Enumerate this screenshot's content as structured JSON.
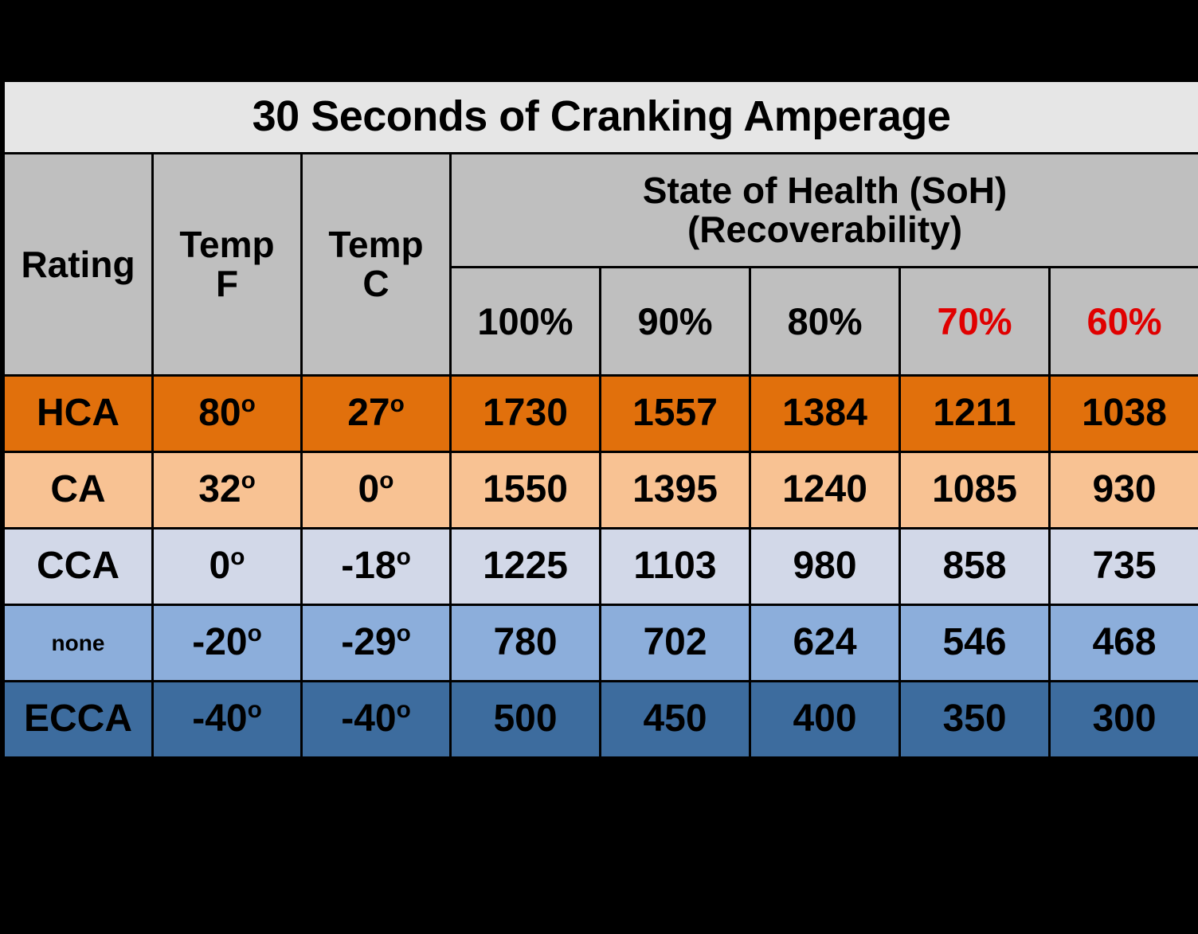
{
  "title": "30 Seconds of Cranking Amperage",
  "header": {
    "rating": "Rating",
    "temp_f_line1": "Temp",
    "temp_f_line2": "F",
    "temp_c_line1": "Temp",
    "temp_c_line2": "C",
    "soh_line1": "State of Health (SoH)",
    "soh_line2": "(Recoverability)",
    "soh_columns": [
      "100%",
      "90%",
      "80%",
      "70%",
      "60%"
    ],
    "soh_column_colors": [
      "#000000",
      "#000000",
      "#000000",
      "#E00000",
      "#E00000"
    ]
  },
  "colors": {
    "title_bg": "#E6E6E6",
    "header_bg": "#BFBFBF",
    "row_hca": "#E1700C",
    "row_ca": "#F8C293",
    "row_cca": "#D2D8E8",
    "row_none": "#8CAEDB",
    "row_ecca": "#3D6C9E",
    "border": "#000000",
    "page_bg": "#000000",
    "red_accent": "#E00000"
  },
  "rows": [
    {
      "rating": "HCA",
      "rating_small": false,
      "temp_f": "80",
      "temp_c": "27",
      "values": [
        "1730",
        "1557",
        "1384",
        "1211",
        "1038"
      ]
    },
    {
      "rating": "CA",
      "rating_small": false,
      "temp_f": "32",
      "temp_c": "0",
      "values": [
        "1550",
        "1395",
        "1240",
        "1085",
        "930"
      ]
    },
    {
      "rating": "CCA",
      "rating_small": false,
      "temp_f": "0",
      "temp_c": "-18",
      "values": [
        "1225",
        "1103",
        "980",
        "858",
        "735"
      ]
    },
    {
      "rating": "none",
      "rating_small": true,
      "temp_f": "-20",
      "temp_c": "-29",
      "values": [
        "780",
        "702",
        "624",
        "546",
        "468"
      ]
    },
    {
      "rating": "ECCA",
      "rating_small": false,
      "temp_f": "-40",
      "temp_c": "-40",
      "values": [
        "500",
        "450",
        "400",
        "350",
        "300"
      ]
    }
  ],
  "degree_symbol": "o",
  "chart_data": {
    "type": "table",
    "title": "30 Seconds of Cranking Amperage",
    "column_groups": [
      "Rating",
      "Temp F",
      "Temp C",
      "State of Health (SoH) (Recoverability)"
    ],
    "categories": [
      "100%",
      "90%",
      "80%",
      "70%",
      "60%"
    ],
    "row_labels": [
      "HCA",
      "CA",
      "CCA",
      "none",
      "ECCA"
    ],
    "temp_f": [
      "80",
      "32",
      "0",
      "-20",
      "-40"
    ],
    "temp_c": [
      "27",
      "0",
      "-18",
      "-29",
      "-40"
    ],
    "series": [
      {
        "name": "HCA",
        "values": [
          1730,
          1557,
          1384,
          1211,
          1038
        ]
      },
      {
        "name": "CA",
        "values": [
          1550,
          1395,
          1240,
          1085,
          930
        ]
      },
      {
        "name": "CCA",
        "values": [
          1225,
          1103,
          980,
          858,
          735
        ]
      },
      {
        "name": "none",
        "values": [
          780,
          702,
          624,
          546,
          468
        ]
      },
      {
        "name": "ECCA",
        "values": [
          500,
          450,
          400,
          350,
          300
        ]
      }
    ],
    "xlabel": "State of Health (SoH)",
    "ylabel": "Cranking Amperage"
  }
}
